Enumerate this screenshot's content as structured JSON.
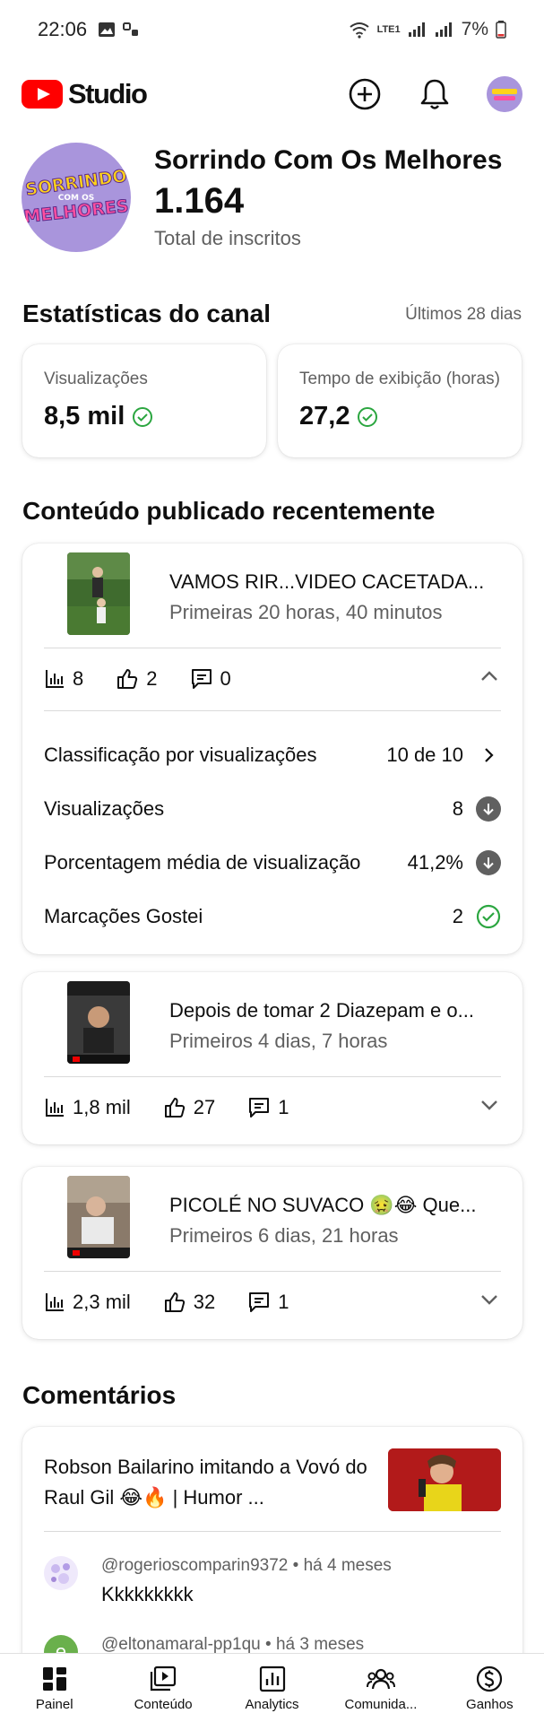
{
  "status_bar": {
    "time": "22:06",
    "network": "LTE1",
    "battery": "7%"
  },
  "header": {
    "app_name": "Studio",
    "create_label": "Criar",
    "notifications_label": "Notificações"
  },
  "channel": {
    "name": "Sorrindo Com Os Melhores",
    "subscribers": "1.164",
    "subscribers_label": "Total de inscritos",
    "avatar_text": [
      "SORRINDO",
      "COM OS",
      "MELHORES"
    ]
  },
  "stats": {
    "title": "Estatísticas do canal",
    "period": "Últimos 28 dias",
    "cards": [
      {
        "label": "Visualizações",
        "value": "8,5 mil"
      },
      {
        "label": "Tempo de exibição (horas)",
        "value": "27,2"
      }
    ]
  },
  "recent": {
    "title": "Conteúdo publicado recentemente",
    "videos": [
      {
        "title": "VAMOS RIR...VIDEO CACETADA...",
        "period": "Primeiras 20 horas, 40 minutos",
        "views": "8",
        "likes": "2",
        "comments": "0",
        "details": [
          {
            "label": "Classificação por visualizações",
            "value": "10 de 10"
          },
          {
            "label": "Visualizações",
            "value": "8"
          },
          {
            "label": "Porcentagem média de visualização",
            "value": "41,2%"
          },
          {
            "label": "Marcações Gostei",
            "value": "2"
          }
        ]
      },
      {
        "title": "Depois de tomar 2 Diazepam e o...",
        "period": "Primeiros 4 dias, 7 horas",
        "views": "1,8 mil",
        "likes": "27",
        "comments": "1",
        "thumb_caption": "INSCREVA-SE"
      },
      {
        "title": "PICOLÉ NO SUVACO 🤢😂 Que...",
        "period": "Primeiros 6 dias, 21 horas",
        "views": "2,3 mil",
        "likes": "32",
        "comments": "1"
      }
    ]
  },
  "comments": {
    "title": "Comentários",
    "video_title": "Robson Bailarino imitando a Vovó do Raul Gil 😂🔥 | Humor ...",
    "items": [
      {
        "author": "@rogerioscomparin9372",
        "time": "há 4 meses",
        "text": "Kkkkkkkkk",
        "avatar_color": "#c9b8ef"
      },
      {
        "author": "@eltonamaral-pp1qu",
        "time": "há 3 meses",
        "text": "",
        "avatar_letter": "e",
        "avatar_color": "#6ab04c"
      }
    ]
  },
  "bottom_nav": [
    {
      "label": "Painel"
    },
    {
      "label": "Conteúdo"
    },
    {
      "label": "Analytics"
    },
    {
      "label": "Comunida..."
    },
    {
      "label": "Ganhos"
    }
  ],
  "colors": {
    "brand_red": "#ff0000",
    "success_green": "#2ba640",
    "text_primary": "#0f0f0f",
    "text_secondary": "#606060"
  }
}
